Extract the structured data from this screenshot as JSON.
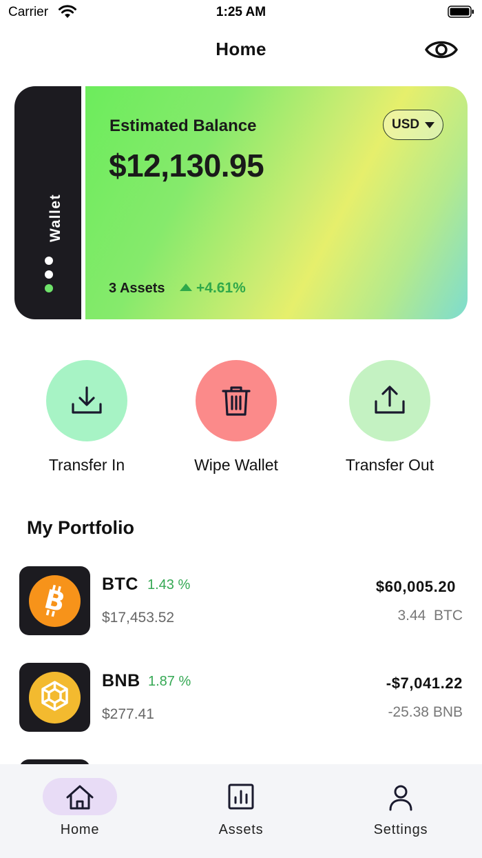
{
  "status_bar": {
    "carrier": "Carrier",
    "time": "1:25 AM"
  },
  "header": {
    "title": "Home",
    "visibility_icon": "eye-icon"
  },
  "wallet_card": {
    "spine_label": "Wallet",
    "balance_label": "Estimated Balance",
    "balance_value": "$12,130.95",
    "currency": "USD",
    "assets_count": "3 Assets",
    "change": "+4.61%",
    "gradient_colors": [
      "#6cec5c",
      "#e6ef6c",
      "#7ddccf"
    ]
  },
  "actions": [
    {
      "label": "Transfer In",
      "icon": "download-icon",
      "color": "#a7f3c5"
    },
    {
      "label": "Wipe Wallet",
      "icon": "trash-icon",
      "color": "#fb8a8a"
    },
    {
      "label": "Transfer Out",
      "icon": "upload-icon",
      "color": "#c4f2c2"
    }
  ],
  "portfolio": {
    "title": "My Portfolio",
    "coins": [
      {
        "symbol": "BTC",
        "change": "1.43 %",
        "price": "$17,453.52",
        "value": "$60,005.20",
        "holding": "3.44  BTC",
        "icon": "bitcoin-icon",
        "color": "#f7931a"
      },
      {
        "symbol": "BNB",
        "change": "1.87 %",
        "price": "$277.41",
        "value": "-$7,041.22",
        "holding": "-25.38 BNB",
        "icon": "binance-coin-icon",
        "color": "#f3ba2f"
      }
    ]
  },
  "tab_bar": {
    "tabs": [
      {
        "label": "Home",
        "icon": "home-icon",
        "active": true
      },
      {
        "label": "Assets",
        "icon": "bar-chart-icon",
        "active": false
      },
      {
        "label": "Settings",
        "icon": "user-icon",
        "active": false
      }
    ]
  },
  "colors": {
    "positive": "#34a853",
    "dark_tile": "#1c1b20",
    "active_tab": "#e8dcf6"
  }
}
